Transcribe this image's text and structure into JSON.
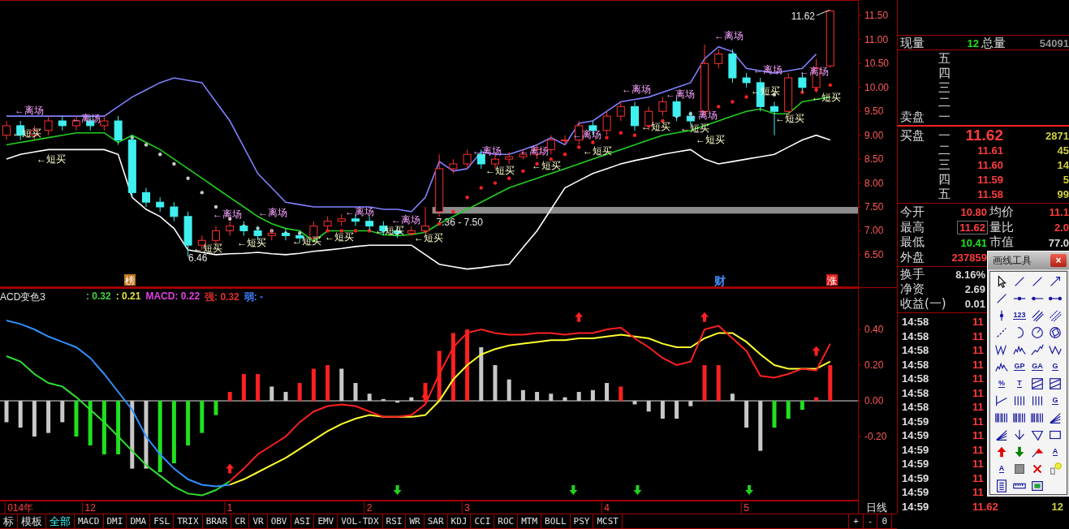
{
  "price_chart": {
    "chart_data": {
      "type": "candlestick",
      "categories": [
        null,
        null,
        null,
        null,
        null,
        null,
        null,
        null,
        null,
        null,
        null,
        null,
        null,
        null,
        null,
        null,
        null,
        null,
        null,
        null,
        null,
        null,
        null,
        null,
        null,
        null,
        null,
        null,
        null,
        null,
        null,
        null,
        null,
        null,
        null,
        null,
        null,
        null,
        null,
        null,
        null,
        null,
        null,
        null,
        null,
        null,
        null,
        null,
        null,
        null,
        null,
        null,
        null,
        null,
        null,
        null,
        null,
        null,
        null,
        null
      ],
      "ylim": [
        5.82,
        11.83
      ],
      "yticks": [
        {
          "value": 11.5,
          "label": "11.50"
        },
        {
          "value": 11.0,
          "label": "11.00"
        },
        {
          "value": 10.5,
          "label": "10.50"
        },
        {
          "value": 10.0,
          "label": "10.00"
        },
        {
          "value": 9.5,
          "label": "9.50"
        },
        {
          "value": 9.0,
          "label": "9.00"
        },
        {
          "value": 8.5,
          "label": "8.50"
        },
        {
          "value": 8.0,
          "label": "8.00"
        },
        {
          "value": 7.5,
          "label": "7.50"
        },
        {
          "value": 7.0,
          "label": "7.00"
        },
        {
          "value": 6.5,
          "label": "6.50"
        }
      ],
      "ohlc": [
        [
          9.0,
          9.3,
          8.9,
          9.2
        ],
        [
          9.2,
          9.3,
          8.9,
          9.0
        ],
        [
          9.0,
          9.2,
          8.9,
          9.1
        ],
        [
          9.1,
          9.4,
          9.0,
          9.3
        ],
        [
          9.3,
          9.4,
          9.1,
          9.2
        ],
        [
          9.2,
          9.4,
          9.1,
          9.3
        ],
        [
          9.3,
          9.4,
          9.1,
          9.2
        ],
        [
          9.2,
          9.4,
          9.1,
          9.3
        ],
        [
          9.3,
          9.4,
          8.8,
          8.9
        ],
        [
          8.9,
          9.0,
          7.7,
          7.8
        ],
        [
          7.8,
          7.9,
          7.5,
          7.6
        ],
        [
          7.6,
          7.7,
          7.4,
          7.5
        ],
        [
          7.5,
          7.6,
          7.2,
          7.3
        ],
        [
          7.3,
          7.4,
          6.46,
          6.7
        ],
        [
          6.7,
          6.9,
          6.6,
          6.8
        ],
        [
          6.8,
          7.1,
          6.7,
          7.0
        ],
        [
          7.0,
          7.2,
          6.9,
          7.1
        ],
        [
          7.1,
          7.2,
          6.9,
          7.0
        ],
        [
          7.0,
          7.1,
          6.8,
          6.9
        ],
        [
          6.9,
          7.05,
          6.8,
          6.95
        ],
        [
          6.95,
          7.05,
          6.8,
          6.9
        ],
        [
          6.9,
          7.0,
          6.75,
          6.85
        ],
        [
          6.85,
          7.2,
          6.8,
          7.1
        ],
        [
          7.1,
          7.3,
          7.0,
          7.2
        ],
        [
          7.2,
          7.35,
          7.1,
          7.25
        ],
        [
          7.25,
          7.35,
          7.1,
          7.2
        ],
        [
          7.2,
          7.3,
          7.0,
          7.1
        ],
        [
          7.1,
          7.2,
          6.9,
          7.0
        ],
        [
          7.0,
          7.1,
          6.85,
          6.95
        ],
        [
          6.95,
          7.1,
          6.9,
          7.0
        ],
        [
          7.0,
          7.5,
          6.95,
          7.1
        ],
        [
          7.4,
          8.6,
          7.3,
          8.3
        ],
        [
          8.3,
          8.5,
          8.2,
          8.4
        ],
        [
          8.4,
          8.7,
          8.3,
          8.6
        ],
        [
          8.6,
          8.7,
          8.3,
          8.4
        ],
        [
          8.4,
          8.6,
          8.3,
          8.5
        ],
        [
          8.5,
          8.65,
          8.4,
          8.55
        ],
        [
          8.55,
          8.7,
          8.5,
          8.6
        ],
        [
          8.6,
          8.8,
          8.5,
          8.7
        ],
        [
          8.7,
          9.0,
          8.6,
          8.9
        ],
        [
          8.9,
          9.0,
          8.8,
          8.9
        ],
        [
          8.9,
          9.3,
          8.8,
          9.2
        ],
        [
          9.2,
          9.3,
          9.0,
          9.1
        ],
        [
          9.1,
          9.5,
          9.0,
          9.4
        ],
        [
          9.4,
          9.7,
          9.3,
          9.6
        ],
        [
          9.6,
          9.7,
          9.1,
          9.2
        ],
        [
          9.2,
          9.6,
          9.1,
          9.5
        ],
        [
          9.5,
          9.8,
          9.4,
          9.7
        ],
        [
          9.7,
          9.8,
          9.3,
          9.4
        ],
        [
          9.4,
          9.5,
          9.2,
          9.3
        ],
        [
          9.5,
          10.9,
          9.4,
          10.5
        ],
        [
          10.5,
          10.8,
          10.4,
          10.7
        ],
        [
          10.7,
          10.8,
          10.1,
          10.2
        ],
        [
          10.2,
          10.3,
          10.0,
          10.1
        ],
        [
          10.1,
          10.2,
          9.5,
          9.6
        ],
        [
          9.6,
          9.7,
          9.0,
          9.5
        ],
        [
          9.5,
          10.3,
          9.4,
          10.2
        ],
        [
          10.2,
          10.3,
          9.9,
          10.0
        ],
        [
          10.0,
          10.6,
          9.9,
          10.4
        ],
        [
          10.45,
          11.62,
          10.41,
          11.6
        ]
      ]
    },
    "band_lines": {
      "chart_data": {
        "type": "line",
        "ylim": [
          5.82,
          11.83
        ],
        "series": [
          {
            "color": "#8080ff",
            "values": [
              9.4,
              9.4,
              9.4,
              9.4,
              9.4,
              9.4,
              9.4,
              9.4,
              9.6,
              9.8,
              9.95,
              10.1,
              10.2,
              10.15,
              10.1,
              9.7,
              9.3,
              8.75,
              8.2,
              7.9,
              7.6,
              7.55,
              7.5,
              7.5,
              7.5,
              7.5,
              7.5,
              7.45,
              7.45,
              7.4,
              7.7,
              8.45,
              8.25,
              8.3,
              8.65,
              8.6,
              8.6,
              8.7,
              8.8,
              8.95,
              8.8,
              9.25,
              9.3,
              9.5,
              9.7,
              9.75,
              9.8,
              9.9,
              10.0,
              10.1,
              10.6,
              10.85,
              10.75,
              10.4,
              10.35,
              10.3,
              10.35,
              10.4,
              10.7,
              null
            ]
          },
          {
            "color": "#20d020",
            "values": [
              8.8,
              8.85,
              8.9,
              8.95,
              9.0,
              9.05,
              9.05,
              9.05,
              8.85,
              9.0,
              8.85,
              8.7,
              8.5,
              8.3,
              8.1,
              7.9,
              7.7,
              7.5,
              7.3,
              7.15,
              7.05,
              7.0,
              6.78,
              7.0,
              7.0,
              7.0,
              7.0,
              6.92,
              6.9,
              6.92,
              6.97,
              7.15,
              7.3,
              7.45,
              7.6,
              7.75,
              7.9,
              8.0,
              8.1,
              8.2,
              8.3,
              8.4,
              8.5,
              8.6,
              8.7,
              8.8,
              8.9,
              9.0,
              9.05,
              9.1,
              9.2,
              9.3,
              9.4,
              9.5,
              9.55,
              9.45,
              9.45,
              9.7,
              9.75,
              9.8
            ]
          },
          {
            "color": "#ffffff",
            "values": [
              8.5,
              8.6,
              8.65,
              8.7,
              8.7,
              8.7,
              8.7,
              8.7,
              8.6,
              7.7,
              7.45,
              7.3,
              7.05,
              6.6,
              6.55,
              6.5,
              6.52,
              6.53,
              6.55,
              6.52,
              6.5,
              6.53,
              6.57,
              6.6,
              6.63,
              6.67,
              6.7,
              6.7,
              6.7,
              6.7,
              6.5,
              6.3,
              6.25,
              6.2,
              6.23,
              6.27,
              6.3,
              6.65,
              7.0,
              7.45,
              7.9,
              8.05,
              8.2,
              8.3,
              8.4,
              8.47,
              8.53,
              8.6,
              8.65,
              8.7,
              8.5,
              8.4,
              8.45,
              8.5,
              8.55,
              8.6,
              8.75,
              8.9,
              9.0,
              8.9
            ]
          }
        ]
      }
    },
    "range_label": "7.36 - 7.50",
    "high_label": "11.62",
    "low_label": "6.46",
    "signals": [
      {
        "kind": "exit",
        "text": "←离场"
      },
      {
        "kind": "buy",
        "text": "←短买"
      },
      {
        "kind": "buy",
        "text": "←短买"
      },
      {
        "kind": "exit",
        "text": "←离场"
      },
      {
        "kind": "buy",
        "text": "←短买"
      },
      {
        "kind": "exit",
        "text": "←离场"
      },
      {
        "kind": "buy",
        "text": "←短买"
      },
      {
        "kind": "exit",
        "text": "←离场"
      },
      {
        "kind": "buy",
        "text": "←短买"
      },
      {
        "kind": "buy",
        "text": "←短买"
      },
      {
        "kind": "exit",
        "text": "←离场"
      },
      {
        "kind": "buy",
        "text": "←短买"
      },
      {
        "kind": "exit",
        "text": "←离场"
      },
      {
        "kind": "buy",
        "text": "←短买"
      },
      {
        "kind": "exit",
        "text": "←离场"
      },
      {
        "kind": "buy",
        "text": "←短买"
      },
      {
        "kind": "exit",
        "text": "←离场"
      },
      {
        "kind": "buy",
        "text": "←短买"
      },
      {
        "kind": "exit",
        "text": "←离场"
      },
      {
        "kind": "buy",
        "text": "←短买"
      },
      {
        "kind": "exit",
        "text": "←离场"
      },
      {
        "kind": "buy",
        "text": "←短买"
      },
      {
        "kind": "exit",
        "text": "←离场"
      },
      {
        "kind": "exit",
        "text": "←离场"
      },
      {
        "kind": "buy",
        "text": "←短买"
      },
      {
        "kind": "buy",
        "text": "←短买"
      },
      {
        "kind": "exit",
        "text": "←离场"
      },
      {
        "kind": "exit",
        "text": "←离场"
      },
      {
        "kind": "buy",
        "text": "←短买"
      },
      {
        "kind": "buy",
        "text": "←短买"
      },
      {
        "kind": "exit",
        "text": "←离场"
      },
      {
        "kind": "buy",
        "text": "←短买"
      }
    ],
    "events": [
      {
        "kind": "tag",
        "text": "榜",
        "color": "#c07820"
      },
      {
        "kind": "text",
        "text": "财",
        "color": "#4090ff"
      },
      {
        "kind": "tag",
        "text": "涨",
        "color": "#e02020"
      }
    ]
  },
  "macd_panel": {
    "title": "ACD变色3",
    "readings": [
      {
        "text": ": 0.32",
        "color": "#40d040"
      },
      {
        "text": ": 0.21",
        "color": "#e0e040"
      },
      {
        "text": "MACD: 0.22",
        "color": "#e040e0"
      },
      {
        "text": "强: 0.32",
        "color": "#e03030"
      },
      {
        "text": "弱: -",
        "color": "#4080ff"
      }
    ],
    "histogram": {
      "chart_data": {
        "type": "bar",
        "stacked": true,
        "ylim": [
          -0.559,
          0.632
        ],
        "categories": [
          null,
          "014年",
          null,
          null,
          null,
          null,
          "12",
          null,
          null,
          null,
          null,
          null,
          null,
          null,
          null,
          null,
          "1",
          null,
          null,
          null,
          null,
          null,
          null,
          null,
          null,
          null,
          "2",
          null,
          null,
          null,
          null,
          null,
          null,
          "3",
          null,
          null,
          null,
          null,
          null,
          null,
          null,
          null,
          null,
          "4",
          null,
          null,
          null,
          null,
          null,
          null,
          null,
          null,
          null,
          "5",
          null,
          null,
          null,
          null,
          null,
          null
        ],
        "yticks": [
          {
            "value": 0.4,
            "label": "0.40"
          },
          {
            "value": 0.2,
            "label": "0.20"
          },
          {
            "value": 0,
            "label": "0.00"
          },
          {
            "value": -0.2,
            "label": "-0.20"
          }
        ],
        "series": [
          {
            "color": "#ff2020",
            "values": [
              null,
              null,
              null,
              null,
              null,
              null,
              null,
              null,
              null,
              null,
              null,
              null,
              null,
              null,
              null,
              null,
              0.05,
              0.15,
              0.15,
              null,
              null,
              0.1,
              0.18,
              0.2,
              null,
              null,
              null,
              null,
              null,
              null,
              0.1,
              0.28,
              0.38,
              0.4,
              null,
              null,
              null,
              null,
              null,
              null,
              null,
              null,
              null,
              null,
              0.08,
              null,
              null,
              null,
              null,
              null,
              0.2,
              0.2,
              null,
              null,
              null,
              null,
              null,
              null,
              0.02,
              0.2
            ]
          },
          {
            "color": "#c8c8c8",
            "values": [
              -0.12,
              -0.15,
              -0.2,
              -0.18,
              -0.12,
              null,
              null,
              null,
              null,
              -0.38,
              -0.38,
              null,
              null,
              null,
              null,
              null,
              null,
              null,
              null,
              0.08,
              0.05,
              null,
              null,
              null,
              0.18,
              0.1,
              0.04,
              0.01,
              -0.01,
              0.02,
              null,
              null,
              null,
              null,
              0.3,
              0.2,
              0.12,
              0.06,
              0.05,
              0.04,
              0.02,
              0.05,
              0.06,
              0.1,
              null,
              -0.02,
              -0.06,
              -0.1,
              -0.1,
              -0.03,
              null,
              null,
              0.04,
              -0.15,
              -0.28,
              null,
              null,
              null,
              null,
              null
            ]
          },
          {
            "color": "#20e020",
            "values": [
              null,
              null,
              null,
              null,
              null,
              -0.2,
              -0.25,
              -0.3,
              -0.3,
              null,
              null,
              -0.4,
              -0.35,
              -0.25,
              -0.18,
              -0.08,
              null,
              null,
              null,
              null,
              null,
              null,
              null,
              null,
              null,
              null,
              null,
              null,
              null,
              null,
              null,
              null,
              null,
              null,
              null,
              null,
              null,
              null,
              null,
              null,
              null,
              null,
              null,
              null,
              null,
              null,
              null,
              null,
              null,
              null,
              null,
              null,
              null,
              null,
              null,
              -0.15,
              -0.1,
              -0.05,
              null,
              null
            ]
          }
        ]
      }
    },
    "lines": {
      "chart_data": {
        "type": "line",
        "ylim": [
          -0.559,
          0.632
        ],
        "series": [
          {
            "color": "#30e030",
            "values": [
              0.25,
              0.22,
              0.15,
              0.1,
              0.08,
              0.02,
              -0.05,
              -0.12,
              -0.2,
              -0.28,
              -0.36,
              -0.42,
              -0.48,
              -0.52,
              -0.53,
              -0.5,
              -0.45,
              null,
              null,
              null,
              null,
              null,
              null,
              null,
              null,
              null,
              null,
              null,
              null,
              null,
              null,
              null,
              null,
              null,
              null,
              null,
              null,
              null,
              null,
              null,
              null,
              null,
              null,
              null,
              null,
              null,
              null,
              null,
              null,
              null,
              null,
              null,
              null,
              null,
              null,
              null,
              null,
              null,
              null,
              null
            ]
          },
          {
            "color": "#3090ff",
            "values": [
              0.45,
              0.43,
              0.4,
              0.36,
              0.33,
              0.3,
              0.24,
              0.15,
              0.05,
              -0.05,
              -0.2,
              -0.3,
              -0.38,
              -0.44,
              -0.47,
              -0.48,
              -0.47,
              null,
              null,
              null,
              null,
              null,
              null,
              null,
              null,
              null,
              null,
              null,
              null,
              null,
              null,
              null,
              null,
              null,
              null,
              null,
              null,
              null,
              null,
              null,
              null,
              null,
              null,
              null,
              null,
              null,
              null,
              null,
              null,
              null,
              null,
              null,
              null,
              null,
              null,
              null,
              null,
              null,
              null,
              null
            ]
          },
          {
            "color": "#ffff30",
            "values": [
              null,
              null,
              null,
              null,
              null,
              null,
              null,
              null,
              null,
              null,
              null,
              null,
              null,
              null,
              null,
              null,
              -0.47,
              -0.44,
              -0.4,
              -0.36,
              -0.32,
              -0.27,
              -0.22,
              -0.17,
              -0.13,
              -0.1,
              -0.08,
              -0.09,
              -0.09,
              -0.09,
              -0.08,
              0.0,
              0.12,
              0.2,
              0.26,
              0.29,
              0.31,
              0.32,
              0.33,
              0.34,
              0.34,
              0.35,
              0.35,
              0.36,
              0.37,
              0.36,
              0.35,
              0.32,
              0.3,
              0.3,
              0.35,
              0.38,
              0.38,
              0.33,
              0.26,
              0.2,
              0.18,
              0.18,
              0.18,
              0.22
            ]
          },
          {
            "color": "#ff2020",
            "values": [
              null,
              null,
              null,
              null,
              null,
              null,
              null,
              null,
              null,
              null,
              null,
              null,
              null,
              null,
              null,
              null,
              -0.45,
              -0.38,
              -0.3,
              -0.25,
              -0.2,
              -0.12,
              -0.06,
              -0.03,
              -0.02,
              -0.03,
              -0.06,
              -0.09,
              -0.09,
              -0.08,
              -0.02,
              0.15,
              0.3,
              0.38,
              0.4,
              0.38,
              0.37,
              0.37,
              0.38,
              0.38,
              0.37,
              0.38,
              0.38,
              0.4,
              0.41,
              0.35,
              0.3,
              0.24,
              0.2,
              0.22,
              0.4,
              0.42,
              0.35,
              0.28,
              0.14,
              0.13,
              0.15,
              0.18,
              0.17,
              0.32
            ]
          }
        ]
      }
    },
    "period_label": "日线"
  },
  "indicator_tabs": [
    {
      "label": "标",
      "selected": false
    },
    {
      "label": "模板",
      "selected": false
    },
    {
      "label": "全部",
      "selected": true
    },
    {
      "label": "MACD",
      "selected": false
    },
    {
      "label": "DMI",
      "selected": false
    },
    {
      "label": "DMA",
      "selected": false
    },
    {
      "label": "FSL",
      "selected": false
    },
    {
      "label": "TRIX",
      "selected": false
    },
    {
      "label": "BRAR",
      "selected": false
    },
    {
      "label": "CR",
      "selected": false
    },
    {
      "label": "VR",
      "selected": false
    },
    {
      "label": "OBV",
      "selected": false
    },
    {
      "label": "ASI",
      "selected": false
    },
    {
      "label": "EMV",
      "selected": false
    },
    {
      "label": "VOL-TDX",
      "selected": false
    },
    {
      "label": "RSI",
      "selected": false
    },
    {
      "label": "WR",
      "selected": false
    },
    {
      "label": "SAR",
      "selected": false
    },
    {
      "label": "KDJ",
      "selected": false
    },
    {
      "label": "CCI",
      "selected": false
    },
    {
      "label": "ROC",
      "selected": false
    },
    {
      "label": "MTM",
      "selected": false
    },
    {
      "label": "BOLL",
      "selected": false
    },
    {
      "label": "PSY",
      "selected": false
    },
    {
      "label": "MCST",
      "selected": false
    }
  ],
  "zoom_buttons": [
    "+",
    "-",
    "0"
  ],
  "quote": {
    "volume": {
      "now_label": "现量",
      "now_value": "12",
      "total_label": "总量",
      "total_value": "54091"
    },
    "asks": {
      "label": "卖盘",
      "levels": [
        "五",
        "四",
        "三",
        "二",
        "一"
      ]
    },
    "bids": {
      "label": "买盘",
      "levels": [
        {
          "level": "一",
          "price": "11.62",
          "volume": "2871"
        },
        {
          "level": "二",
          "price": "11.61",
          "volume": "45"
        },
        {
          "level": "三",
          "price": "11.60",
          "volume": "14"
        },
        {
          "level": "四",
          "price": "11.59",
          "volume": "5"
        },
        {
          "level": "五",
          "price": "11.58",
          "volume": "99"
        }
      ]
    },
    "stats": [
      {
        "label": "今开",
        "value": "10.80",
        "color": "#ff3c3c",
        "boxed": false
      },
      {
        "label": "均价",
        "value": "11.1",
        "color": "#ff3c3c",
        "boxed": false
      },
      {
        "label": "最高",
        "value": "11.62",
        "color": "#ff3c3c",
        "boxed": true
      },
      {
        "label": "量比",
        "value": "2.0",
        "color": "#ff3c3c",
        "boxed": false
      },
      {
        "label": "最低",
        "value": "10.41",
        "color": "#20e020",
        "boxed": false
      },
      {
        "label": "市值",
        "value": "77.0",
        "color": "#d8d8d8",
        "boxed": false
      },
      {
        "label": "外盘",
        "value": "237859",
        "color": "#ff3c3c",
        "boxed": false
      }
    ],
    "stats2": [
      {
        "label": "换手",
        "value": "8.16%"
      },
      {
        "label": "净资",
        "value": "2.69"
      },
      {
        "label": "收益(一)",
        "value": "0.01"
      }
    ],
    "ticks": [
      {
        "time": "14:58",
        "price": "11"
      },
      {
        "time": "14:58",
        "price": "11"
      },
      {
        "time": "14:58",
        "price": "11"
      },
      {
        "time": "14:58",
        "price": "11"
      },
      {
        "time": "14:58",
        "price": "11"
      },
      {
        "time": "14:58",
        "price": "11"
      },
      {
        "time": "14:58",
        "price": "11"
      },
      {
        "time": "14:59",
        "price": "11"
      },
      {
        "time": "14:59",
        "price": "11"
      },
      {
        "time": "14:59",
        "price": "11"
      },
      {
        "time": "14:59",
        "price": "11"
      },
      {
        "time": "14:59",
        "price": "11"
      },
      {
        "time": "14:59",
        "price": "11"
      },
      {
        "time": "14:59",
        "price": "11.62",
        "volume": "12"
      }
    ]
  },
  "drawing_tools": {
    "title": "画线工具",
    "close": "×",
    "tools": [
      {
        "kind": "cursor"
      },
      {
        "kind": "line"
      },
      {
        "kind": "line"
      },
      {
        "kind": "arrow-line"
      },
      {
        "kind": "line"
      },
      {
        "kind": "segment-mid"
      },
      {
        "kind": "segment-left"
      },
      {
        "kind": "segment-ends"
      },
      {
        "kind": "vertical-mark"
      },
      {
        "kind": "text",
        "label": "123"
      },
      {
        "kind": "parallel"
      },
      {
        "kind": "parallel-dotted"
      },
      {
        "kind": "dashed-line"
      },
      {
        "kind": "arc"
      },
      {
        "kind": "circle-line"
      },
      {
        "kind": "circle-polygon"
      },
      {
        "kind": "zigzag"
      },
      {
        "kind": "wave"
      },
      {
        "kind": "zigzag-rise"
      },
      {
        "kind": "zigzag-v"
      },
      {
        "kind": "wave"
      },
      {
        "kind": "text",
        "label": "GP"
      },
      {
        "kind": "text",
        "label": "GA"
      },
      {
        "kind": "text",
        "label": "G"
      },
      {
        "kind": "text",
        "label": "%"
      },
      {
        "kind": "text",
        "label": "T"
      },
      {
        "kind": "box"
      },
      {
        "kind": "box"
      },
      {
        "kind": "line-bars"
      },
      {
        "kind": "vlines"
      },
      {
        "kind": "vlines"
      },
      {
        "kind": "text",
        "label": "G"
      },
      {
        "kind": "vlines-many"
      },
      {
        "kind": "vlines-many"
      },
      {
        "kind": "vlines-many"
      },
      {
        "kind": "fan"
      },
      {
        "kind": "fan"
      },
      {
        "kind": "vee"
      },
      {
        "kind": "triangle"
      },
      {
        "kind": "rectangle"
      },
      {
        "kind": "up-arrow"
      },
      {
        "kind": "down-arrow"
      },
      {
        "kind": "arrow-red"
      },
      {
        "kind": "text",
        "label": "A"
      },
      {
        "kind": "text",
        "label": "A"
      },
      {
        "kind": "gray-square"
      },
      {
        "kind": "red-cross"
      },
      {
        "kind": "bulb"
      },
      {
        "kind": "document"
      },
      {
        "kind": "ruler"
      },
      {
        "kind": "picture"
      }
    ]
  }
}
